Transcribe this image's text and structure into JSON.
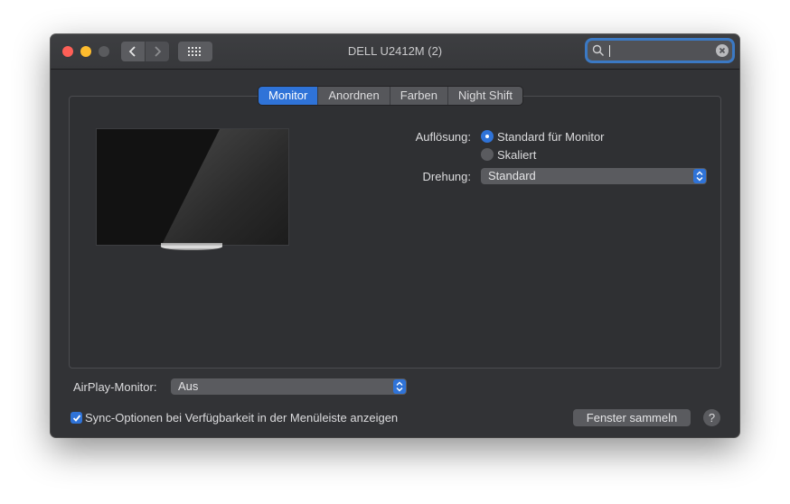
{
  "window": {
    "title": "DELL U2412M (2)"
  },
  "search": {
    "value": "",
    "placeholder": ""
  },
  "tabs": [
    {
      "label": "Monitor",
      "active": true
    },
    {
      "label": "Anordnen",
      "active": false
    },
    {
      "label": "Farben",
      "active": false
    },
    {
      "label": "Night Shift",
      "active": false
    }
  ],
  "display": {
    "resolution_label": "Auflösung:",
    "resolution_options": [
      {
        "label": "Standard für Monitor",
        "selected": true
      },
      {
        "label": "Skaliert",
        "selected": false
      }
    ],
    "rotation_label": "Drehung:",
    "rotation_value": "Standard"
  },
  "airplay": {
    "label": "AirPlay-Monitor:",
    "value": "Aus"
  },
  "sync_option": {
    "label": "Sync-Optionen bei Verfügbarkeit in der Menüleiste anzeigen",
    "checked": true
  },
  "buttons": {
    "gather_windows": "Fenster sammeln",
    "help": "?"
  },
  "icons": {
    "back": "chevron-left-icon",
    "forward": "chevron-right-icon",
    "grid": "grid-icon",
    "search": "search-icon",
    "clear": "clear-icon"
  },
  "colors": {
    "accent": "#2f73d8",
    "window_bg": "#323336",
    "close": "#fe5f57",
    "minimize": "#febc2e"
  }
}
